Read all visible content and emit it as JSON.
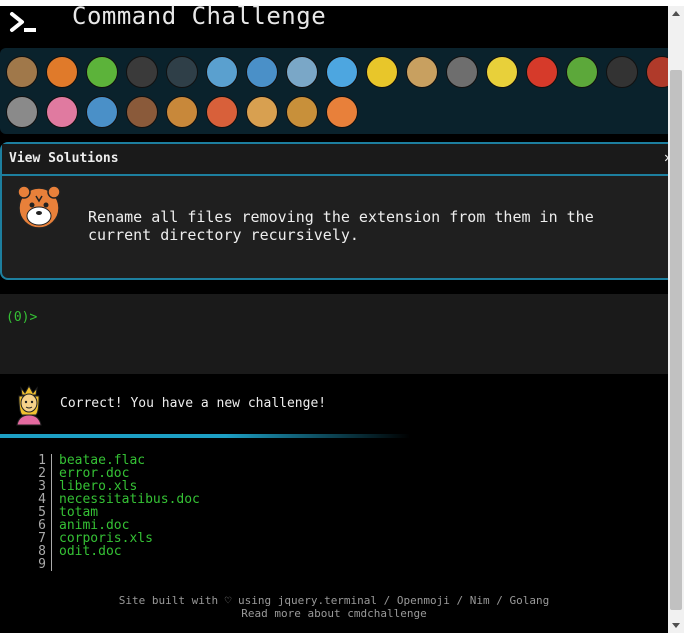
{
  "header": {
    "title": "Command Challenge",
    "logo_icon": "terminal-prompt-icon"
  },
  "emoji_bar": {
    "row1": [
      {
        "name": "snail-icon",
        "color": "#a0784a"
      },
      {
        "name": "butterfly-icon",
        "color": "#e07a2a"
      },
      {
        "name": "caterpillar-icon",
        "color": "#5cb33a"
      },
      {
        "name": "ant-icon",
        "color": "#3a3a3a"
      },
      {
        "name": "spider-web-icon",
        "color": "#2f3f48"
      },
      {
        "name": "whale-icon",
        "color": "#5aa0cf"
      },
      {
        "name": "spouting-whale-icon",
        "color": "#4a90c8"
      },
      {
        "name": "dolphin-icon",
        "color": "#7aa7c7"
      },
      {
        "name": "fish-icon",
        "color": "#4da6e0"
      },
      {
        "name": "tropical-fish-icon",
        "color": "#e8c62a"
      },
      {
        "name": "blowfish-icon",
        "color": "#c8a060"
      },
      {
        "name": "wolf-icon",
        "color": "#6e6e6e"
      },
      {
        "name": "honeybee-icon",
        "color": "#e8d03a"
      },
      {
        "name": "lady-beetle-icon",
        "color": "#d63a2a"
      },
      {
        "name": "cricket-icon",
        "color": "#5ca83a"
      },
      {
        "name": "spider-icon",
        "color": "#333333"
      },
      {
        "name": "scorpion-icon",
        "color": "#b03a2a"
      }
    ],
    "row2": [
      {
        "name": "fly-icon",
        "color": "#8a8a8a"
      },
      {
        "name": "worm-icon",
        "color": "#e07aa0"
      },
      {
        "name": "microbe-icon",
        "color": "#4a90c8"
      },
      {
        "name": "monkey-icon",
        "color": "#8a5a3a"
      },
      {
        "name": "dog-face-icon",
        "color": "#c8883a"
      },
      {
        "name": "fox-icon",
        "color": "#d8603a"
      },
      {
        "name": "cat-face-icon",
        "color": "#d8a050"
      },
      {
        "name": "lion-icon",
        "color": "#c8903a"
      },
      {
        "name": "tiger-face-icon",
        "color": "#e8803a"
      }
    ]
  },
  "solutions": {
    "header_label": "View Solutions",
    "close_label": "✕",
    "challenge_icon": "tiger-face-icon",
    "task": "Rename all files removing the extension from them in the current directory recursively."
  },
  "terminal": {
    "prompt": "(0)>"
  },
  "message": {
    "icon": "princess-icon",
    "text": "Correct! You have a new challenge!"
  },
  "files": {
    "line_numbers": [
      "1",
      "2",
      "3",
      "4",
      "5",
      "6",
      "7",
      "8",
      "9"
    ],
    "names": [
      "beatae.flac",
      "error.doc",
      "libero.xls",
      "necessitatibus.doc",
      "totam",
      "animi.doc",
      "corporis.xls",
      "odit.doc",
      ""
    ]
  },
  "footer": {
    "line1": "Site built with ♡ using jquery.terminal / Openmoji / Nim / Golang",
    "line2": "Read more about cmdchallenge"
  }
}
